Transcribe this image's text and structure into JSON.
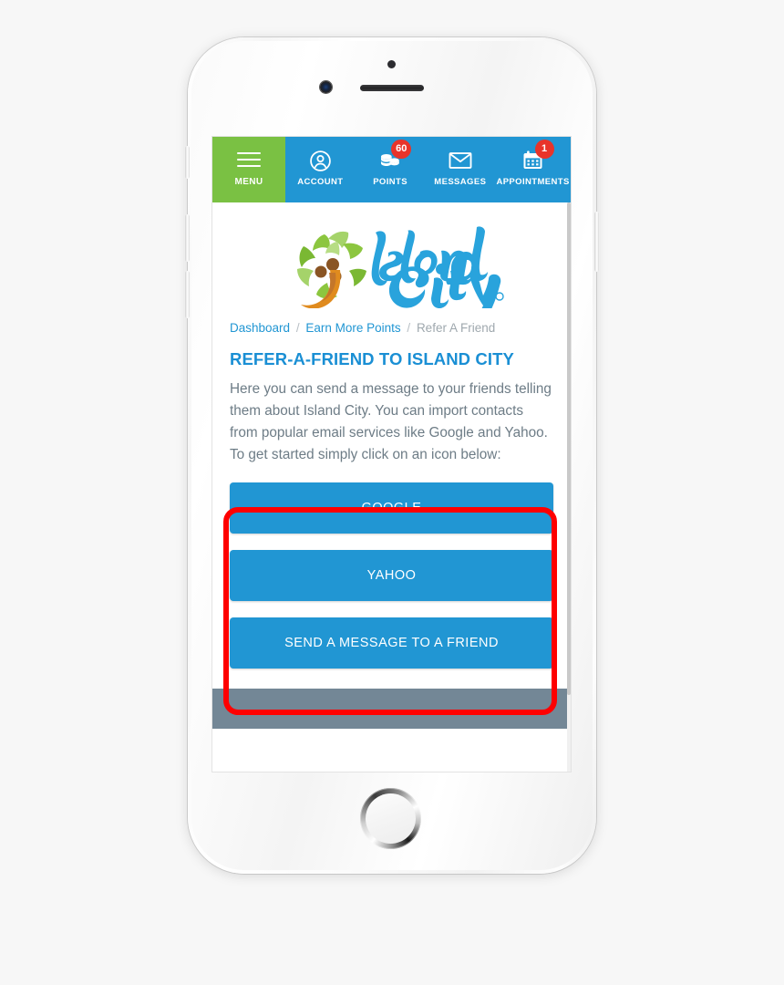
{
  "device": {
    "name": "white-smartphone-mockup",
    "hardware": {
      "mute_switch": "mute-switch",
      "volume_up": "volume-up",
      "volume_down": "volume-down",
      "power": "power-button",
      "home": "home-button",
      "camera": "front-camera",
      "speaker": "earpiece-speaker",
      "sensor": "proximity-sensor"
    }
  },
  "colors": {
    "brand_blue": "#2196d3",
    "brand_green": "#7ac143",
    "badge_red": "#e8342a",
    "highlight_red": "#fe0000",
    "title_blue": "#1a8fd4",
    "body_gray": "#6d7c86",
    "footer_gray": "#738796",
    "page_background": "#f7f7f7"
  },
  "top_nav": {
    "items": [
      {
        "label": "MENU",
        "icon": "hamburger-menu-icon",
        "badge": null
      },
      {
        "label": "ACCOUNT",
        "icon": "user-circle-icon",
        "badge": null
      },
      {
        "label": "POINTS",
        "icon": "coin-stack-icon",
        "badge": "60"
      },
      {
        "label": "MESSAGES",
        "icon": "envelope-icon",
        "badge": null
      },
      {
        "label": "APPOINTMENTS",
        "icon": "calendar-icon",
        "badge": "1"
      }
    ]
  },
  "logo": {
    "alt": "Island City",
    "word_island": "Island",
    "word_city": "City",
    "mark": "palm-tree-icon"
  },
  "breadcrumb": {
    "items": [
      {
        "label": "Dashboard",
        "current": false
      },
      {
        "label": "Earn More Points",
        "current": false
      },
      {
        "label": "Refer A Friend",
        "current": true
      }
    ],
    "separator": "/"
  },
  "main": {
    "title": "REFER-A-FRIEND TO ISLAND CITY",
    "intro": "Here you can send a message to your friends telling them about Island City. You can import contacts from popular email services like Google and Yahoo. To get started simply click on an icon below:",
    "buttons": [
      {
        "label": "GOOGLE"
      },
      {
        "label": "YAHOO"
      },
      {
        "label": "SEND A MESSAGE TO A FRIEND"
      }
    ]
  },
  "footer": {
    "text": ""
  }
}
